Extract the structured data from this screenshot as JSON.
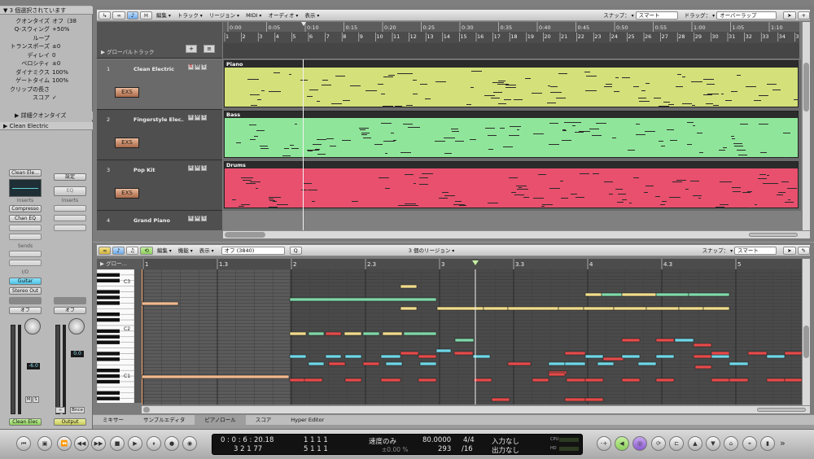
{
  "inspector": {
    "header": "3 個選択されています",
    "params": [
      {
        "k": "クオンタイズ",
        "v": "オフ（38"
      },
      {
        "k": "Q-スウィング",
        "v": "+50%"
      },
      {
        "k": "ループ",
        "v": ""
      },
      {
        "k": "トランスポーズ",
        "v": "±0"
      },
      {
        "k": "ディレイ",
        "v": "0"
      },
      {
        "k": "ベロシティ",
        "v": "±0"
      },
      {
        "k": "ダイナミクス",
        "v": "100%"
      },
      {
        "k": "ゲートタイム",
        "v": "100%"
      },
      {
        "k": "クリップの長さ",
        "v": ""
      },
      {
        "k": "スコア",
        "v": "✓"
      }
    ],
    "advanced_quantize": "詳細クオンタイズ",
    "track_section": "Clean Electric",
    "strip_left": {
      "setting": "Clean Ele...",
      "inserts_label": "Inserts",
      "inserts": [
        "Compresso",
        "Chan EQ"
      ],
      "sends_label": "Sends",
      "io_label": "I/O",
      "input": "Guitar",
      "output": "Stereo Out",
      "auto": "オフ",
      "volume": "-6.0",
      "name": "Clean Elec"
    },
    "strip_right": {
      "setting": "設定",
      "eq": "EQ",
      "inserts_label": "Inserts",
      "auto": "オフ",
      "volume": "0.0",
      "bnce": "Bnce",
      "name": "Output"
    }
  },
  "arrange": {
    "toolbar": {
      "menus": [
        "編集",
        "トラック",
        "リージョン",
        "MIDI",
        "オーディオ",
        "表示"
      ],
      "snap_label": "スナップ：",
      "snap_value": "スマート",
      "drag_label": "ドラッグ：",
      "drag_value": "オーバーラップ"
    },
    "global_tracks": "グローバルトラック",
    "ruler_bars": [
      "1",
      "2",
      "3",
      "4",
      "5",
      "6",
      "7",
      "8",
      "9",
      "10",
      "11",
      "12",
      "13",
      "14",
      "15",
      "16",
      "17",
      "18",
      "19",
      "20",
      "21",
      "22",
      "23",
      "24",
      "25",
      "26",
      "27",
      "28",
      "29",
      "30",
      "31",
      "32",
      "33",
      "34",
      "35"
    ],
    "ruler_times": [
      "0:00",
      "0:05",
      "0:10",
      "0:15",
      "0:20",
      "0:25",
      "0:30",
      "0:35",
      "0:40",
      "0:45",
      "0:50",
      "0:55",
      "1:00",
      "1:05",
      "1:10"
    ],
    "tracks": [
      {
        "num": "1",
        "name": "Clean Electric",
        "exs": "EXS",
        "region": "Piano",
        "color": "#d4e07a"
      },
      {
        "num": "2",
        "name": "Fingerstyle Elec...",
        "exs": "EXS",
        "region": "Bass",
        "color": "#8fe69a"
      },
      {
        "num": "3",
        "name": "Pop Kit",
        "exs": "EXS",
        "region": "Drums",
        "color": "#e8506e"
      },
      {
        "num": "4",
        "name": "Grand Piano"
      }
    ]
  },
  "pianoroll": {
    "toolbar": {
      "menus": [
        "編集",
        "機能",
        "表示"
      ],
      "quantize": "オフ (3840)",
      "q_button": "Q",
      "info": "3 個のリージョン",
      "snap_label": "スナップ：",
      "snap_value": "スマート"
    },
    "global_label": "グロー...",
    "bar_labels": [
      "1",
      "1.3",
      "2",
      "2.3",
      "3",
      "3.3",
      "4",
      "4.3",
      "5"
    ],
    "key_labels": [
      "C3",
      "C2",
      "C1"
    ]
  },
  "tabs": [
    "ミキサー",
    "サンプルエディタ",
    "ピアノロール",
    "スコア",
    "Hyper Editor"
  ],
  "active_tab": "ピアノロール",
  "transport": {
    "smpte": "0 : 0 : 6 : 20.18",
    "bars": "3   2   1   77",
    "end1": "1   1   1   1",
    "end2": "5   1   1   1",
    "mode": "速度のみ",
    "tempo_offset": "±0.00 %",
    "tempo": "80.0000",
    "sig": "4/4",
    "bpm_sub": "293",
    "div": "/16",
    "in": "入力なし",
    "out": "出力なし",
    "cpu": "CPU",
    "hd": "HD"
  }
}
